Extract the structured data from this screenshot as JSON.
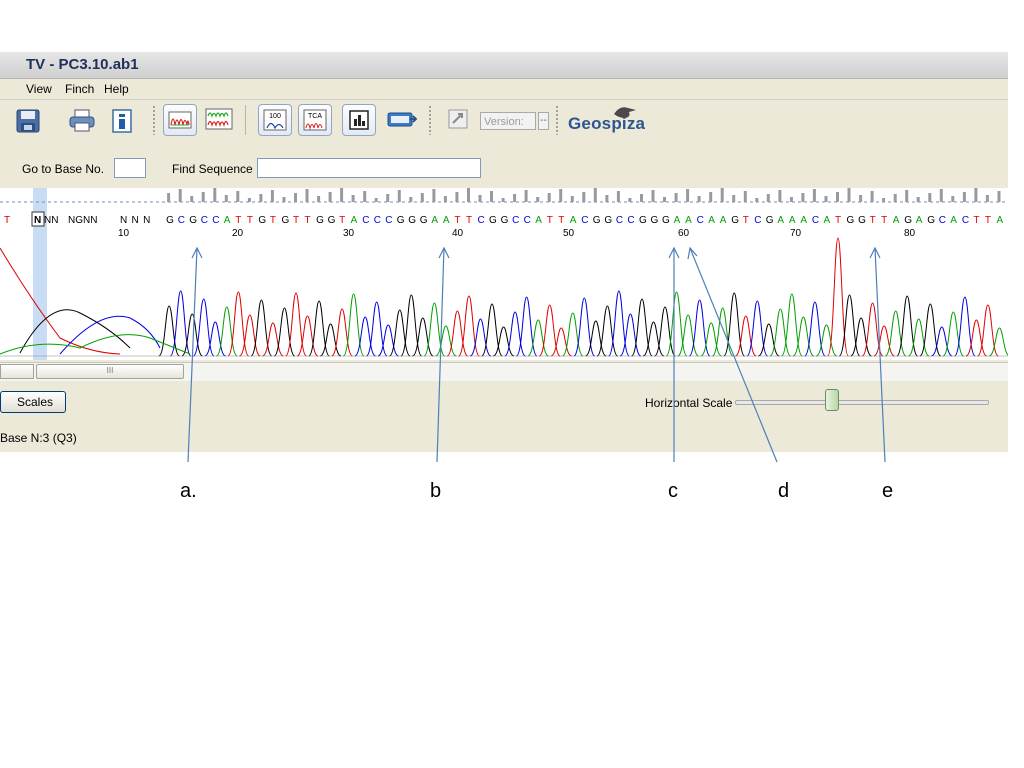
{
  "window": {
    "title": "TV - PC3.10.ab1"
  },
  "menubar": {
    "items": [
      "View",
      "Finch",
      "Help"
    ]
  },
  "toolbar": {
    "buttons": [
      {
        "name": "save-icon"
      },
      {
        "name": "print-icon"
      },
      {
        "name": "info-icon"
      },
      {
        "name": "single-trace-view-icon"
      },
      {
        "name": "stacked-trace-view-icon"
      },
      {
        "name": "quality-100-icon",
        "text": "100"
      },
      {
        "name": "tca-trace-icon",
        "text": "TCA"
      },
      {
        "name": "quality-bars-icon"
      },
      {
        "name": "export-sequence-icon"
      },
      {
        "name": "disabled-tool-icon"
      }
    ],
    "version_label": "Version:",
    "version_value": "--",
    "logo": "Geospiza"
  },
  "findbar": {
    "goto_label": "Go to Base No.",
    "goto_value": "",
    "find_label": "Find Sequence",
    "find_value": ""
  },
  "trace": {
    "bases_text": "NNN GCGCCATTGTGTTGGTACCCGGGAATTCGGCCATTACGGCCGGGAACAAGTCGAAACATGGTTAGAGCACTTA",
    "lead_bases": [
      {
        "text": "T",
        "color": "#d00000"
      },
      {
        "text": "N",
        "color": "#000000",
        "highlight": true
      },
      {
        "text": "NN",
        "color": "#000000"
      },
      {
        "text": "NGNN",
        "color": "#000000"
      }
    ],
    "position_numbers": [
      "10",
      "20",
      "30",
      "40",
      "50",
      "60",
      "70",
      "80"
    ],
    "colors": {
      "A": "#00a000",
      "C": "#0000e0",
      "G": "#000000",
      "T": "#e00000"
    }
  },
  "bottom": {
    "scales_button": "Scales",
    "hscale_label": "Horizontal Scale",
    "hscale_level": 0.38,
    "status": "Base N:3  (Q3)",
    "scroll_grip": "III"
  },
  "annotations": [
    "a.",
    "b",
    "c",
    "d",
    "e"
  ]
}
